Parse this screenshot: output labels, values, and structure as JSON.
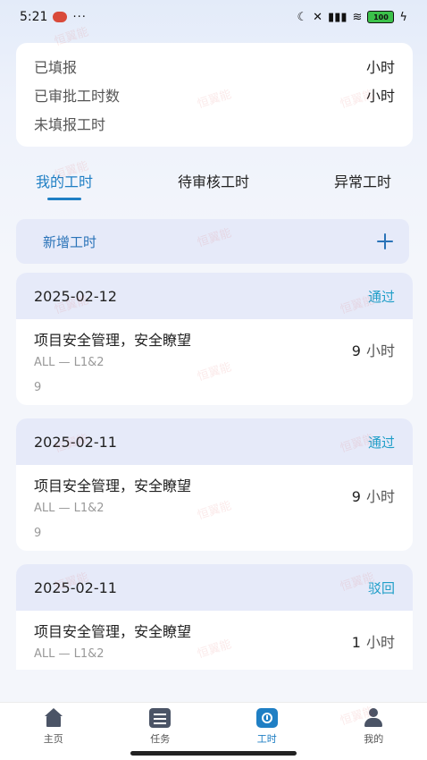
{
  "status_bar": {
    "time": "5:21",
    "more": "···",
    "battery": "100"
  },
  "summary": {
    "rows": [
      {
        "label": "已填报",
        "value": "小时"
      },
      {
        "label": "已审批工时数",
        "value": "小时"
      },
      {
        "label": "未填报工时",
        "value": ""
      }
    ]
  },
  "tabs": [
    {
      "label": "我的工时",
      "active": true
    },
    {
      "label": "待审核工时",
      "active": false
    },
    {
      "label": "异常工时",
      "active": false
    }
  ],
  "add_bar": {
    "label": "新增工时",
    "icon": "plus-icon"
  },
  "records": [
    {
      "date": "2025-02-12",
      "status": "通过",
      "title": "项目安全管理，安全瞭望",
      "sub": "ALL — L1&2",
      "num": "9",
      "hours": "9",
      "unit": "小时"
    },
    {
      "date": "2025-02-11",
      "status": "通过",
      "title": "项目安全管理，安全瞭望",
      "sub": "ALL — L1&2",
      "num": "9",
      "hours": "9",
      "unit": "小时"
    },
    {
      "date": "2025-02-11",
      "status": "驳回",
      "title": "项目安全管理，安全瞭望",
      "sub": "ALL — L1&2",
      "num": "",
      "hours": "1",
      "unit": "小时"
    }
  ],
  "bottom_nav": [
    {
      "label": "主页",
      "icon": "home-icon",
      "active": false
    },
    {
      "label": "任务",
      "icon": "task-icon",
      "active": false
    },
    {
      "label": "工时",
      "icon": "timer-icon",
      "active": true
    },
    {
      "label": "我的",
      "icon": "user-icon",
      "active": false
    }
  ],
  "watermark": "恒翼能",
  "colors": {
    "accent": "#1f7fc4",
    "status": "#1f9ec8",
    "header_bg": "#e6eaf9"
  }
}
